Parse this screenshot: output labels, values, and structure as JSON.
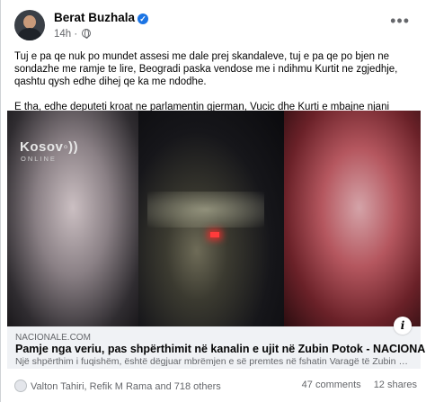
{
  "post": {
    "author": "Berat Buzhala",
    "time": "14h",
    "paragraph1": "Tuj e pa qe nuk po mundet assesi me dale prej skandaleve, tuj e pa qe po bjen ne sondazhe me ramje te lire, Beogradi paska vendose me i ndihmu Kurtit ne zgjedhje, qashtu qysh edhe dihej qe ka me ndodhe.",
    "paragraph2": "E tha, edhe deputeti kroat ne parlamentin gjerman, Vucic dhe Kurti e mbajne njani tjetrin. Hehehehehehehe."
  },
  "media": {
    "watermark": "Kosov",
    "watermark_sub": "ONLINE"
  },
  "link": {
    "domain": "NACIONALE.COM",
    "title": "Pamje nga veriu, pas shpërthimit në kanalin e ujit në Zubin Potok - NACIONALE",
    "description": "Një shpërthim i fuqishëm, është dëgjuar mbrëmjen e së premtes në fshatin Varagë të Zubin Poto..."
  },
  "footer": {
    "reactions": "Valton Tahiri, Refik M Rama and 718 others",
    "comments": "47 comments",
    "shares": "12 shares"
  },
  "icons": {
    "verified": "verified-badge-icon",
    "globe": "globe-icon",
    "more": "more-options-icon",
    "info": "info-icon",
    "reaction": "reaction-icon"
  },
  "colors": {
    "accent": "#1b74e4",
    "secondary_text": "#65676b",
    "link_bg": "#f0f2f5"
  }
}
